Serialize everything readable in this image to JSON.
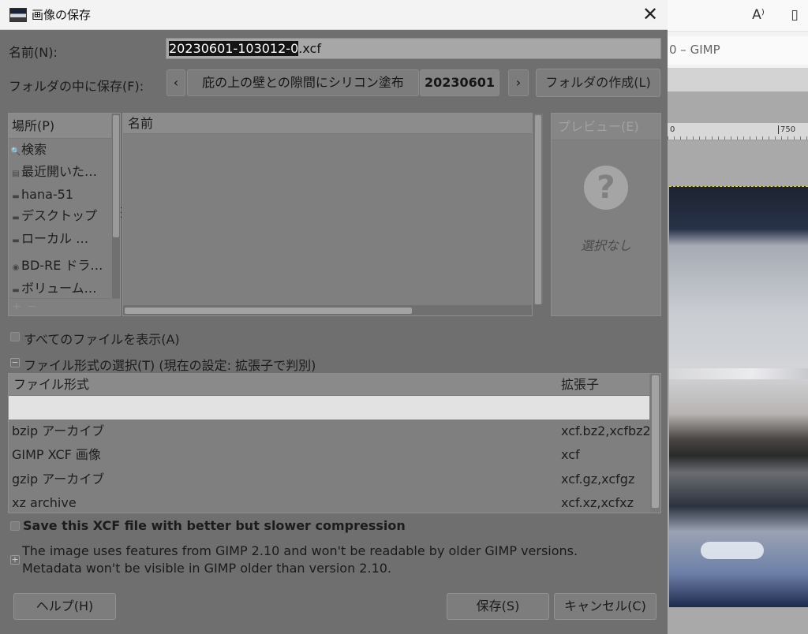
{
  "dialog": {
    "title": "画像の保存",
    "name_label": "名前(N):",
    "filename_selected": "20230601-103012-0",
    "filename_extension": ".xcf",
    "folder_label": "フォルダの中に保存(F):",
    "path_prev": "‹",
    "path_segment": "庇の上の壁との隙間にシリコン塗布",
    "path_current": "20230601",
    "path_next": "›",
    "create_folder": "フォルダの作成(L)"
  },
  "places": {
    "header": "場所(P)",
    "items": [
      {
        "icon": "search",
        "label": "検索"
      },
      {
        "icon": "recent",
        "label": "最近開いた…"
      },
      {
        "icon": "folder",
        "label": "hana-51"
      },
      {
        "icon": "folder",
        "label": "デスクトップ"
      },
      {
        "icon": "drive",
        "label": "ローカル …"
      },
      {
        "icon": "optical-drive",
        "label": "BD-RE ドラ…"
      },
      {
        "icon": "drive",
        "label": "ボリューム…"
      }
    ],
    "add": "+",
    "remove": "−"
  },
  "filelist": {
    "column_name": "名前"
  },
  "preview": {
    "header": "プレビュー(E)",
    "none": "選択なし",
    "icon": "?"
  },
  "options": {
    "show_all_files": "すべてのファイルを表示(A)",
    "file_type_select": "ファイル形式の選択(T) (現在の設定: 拡張子で判別)"
  },
  "filetypes": {
    "col_type": "ファイル形式",
    "col_ext": "拡張子",
    "rows": [
      {
        "type": "bzip アーカイブ",
        "ext": "xcf.bz2,xcfbz2"
      },
      {
        "type": "GIMP XCF 画像",
        "ext": "xcf"
      },
      {
        "type": "gzip アーカイブ",
        "ext": "xcf.gz,xcfgz"
      },
      {
        "type": "xz archive",
        "ext": "xcf.xz,xcfxz"
      }
    ]
  },
  "compression_label": "Save this XCF file with better but slower compression",
  "compat_info": {
    "line1": "The image uses features from GIMP 2.10 and won't be readable by older GIMP versions.",
    "line2": "Metadata won't be visible in GIMP older than version 2.10."
  },
  "buttons": {
    "help": "ヘルプ(H)",
    "save": "保存(S)",
    "cancel": "キャンセル(C)"
  },
  "background_window": {
    "title_fragment": "0 – GIMP",
    "ruler_left": "0",
    "ruler_right": "750",
    "read_aloud_icon": "A⁾",
    "notes_icon": "▯"
  }
}
